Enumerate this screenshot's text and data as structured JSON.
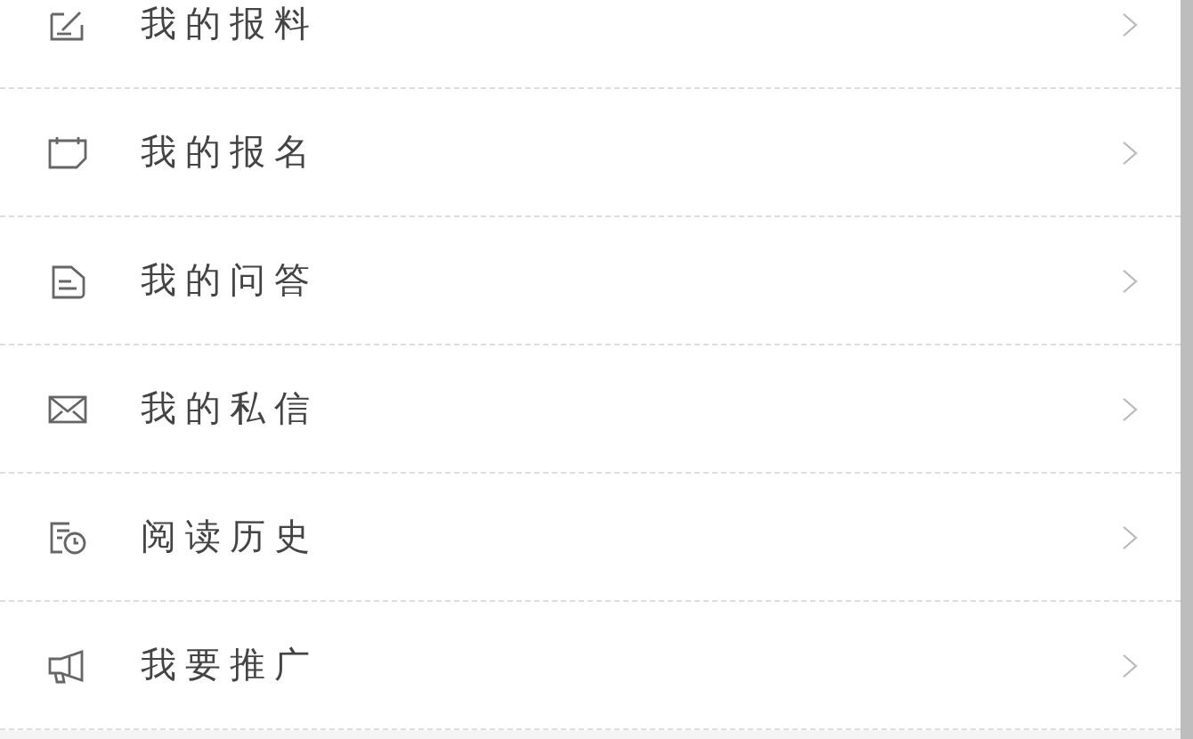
{
  "menu": [
    {
      "label": "我的报料"
    },
    {
      "label": "我的报名"
    },
    {
      "label": "我的问答"
    },
    {
      "label": "我的私信"
    },
    {
      "label": "阅读历史"
    },
    {
      "label": "我要推广"
    }
  ]
}
